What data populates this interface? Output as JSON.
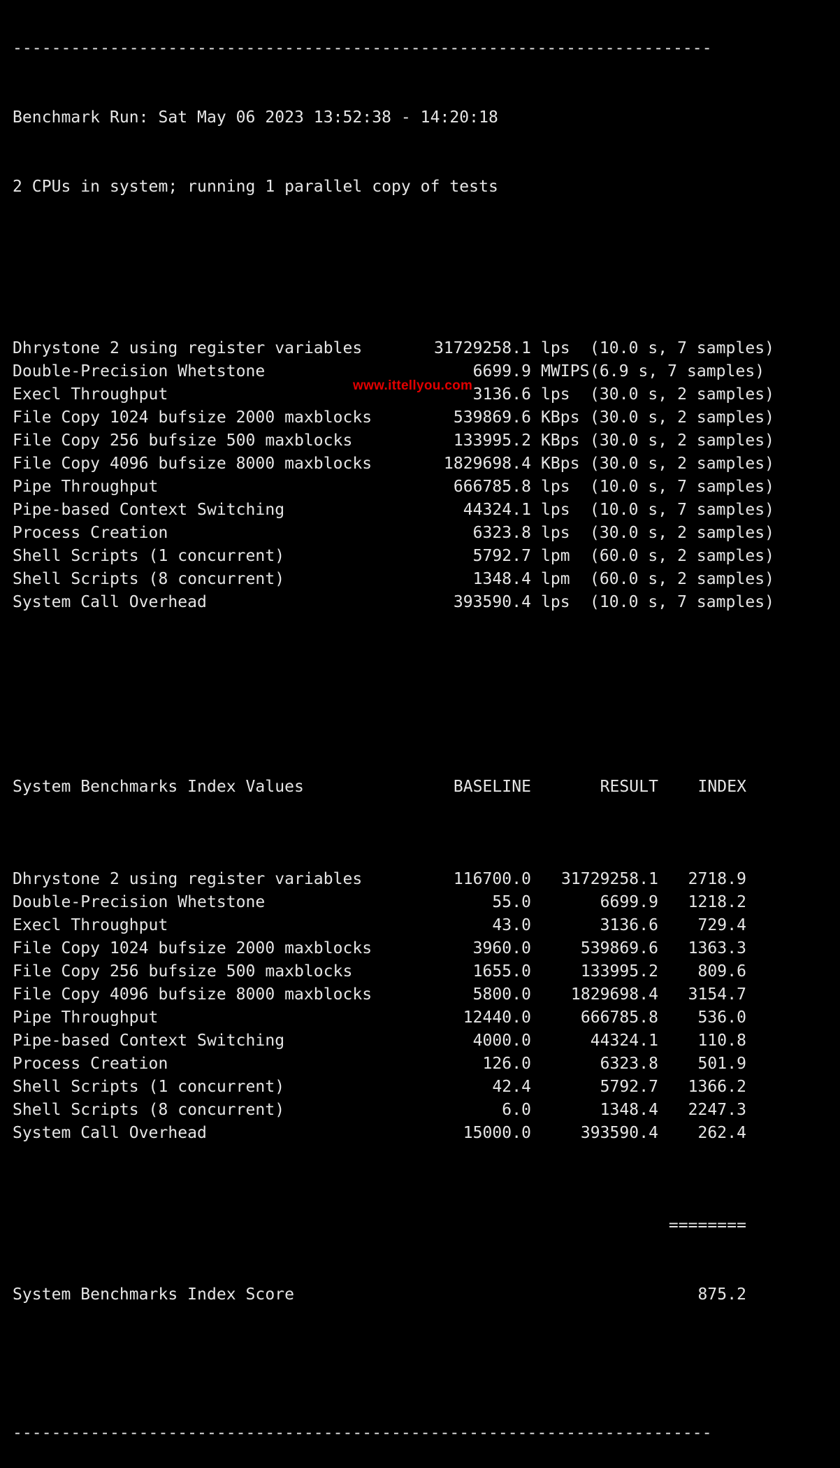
{
  "terminal": {
    "divider_top": "------------------------------------------------------------------------",
    "run_line": "Benchmark Run: Sat May 06 2023 13:52:38 - 14:20:18",
    "cpu_line": "2 CPUs in system; running 1 parallel copy of tests",
    "raw_results": [
      {
        "name": "Dhrystone 2 using register variables",
        "value": "31729258.1",
        "unit": "lps",
        "detail": "(10.0 s, 7 samples)"
      },
      {
        "name": "Double-Precision Whetstone",
        "value": "6699.9",
        "unit": "MWIPS",
        "detail": "(6.9 s, 7 samples)"
      },
      {
        "name": "Execl Throughput",
        "value": "3136.6",
        "unit": "lps",
        "detail": "(30.0 s, 2 samples)"
      },
      {
        "name": "File Copy 1024 bufsize 2000 maxblocks",
        "value": "539869.6",
        "unit": "KBps",
        "detail": "(30.0 s, 2 samples)"
      },
      {
        "name": "File Copy 256 bufsize 500 maxblocks",
        "value": "133995.2",
        "unit": "KBps",
        "detail": "(30.0 s, 2 samples)"
      },
      {
        "name": "File Copy 4096 bufsize 8000 maxblocks",
        "value": "1829698.4",
        "unit": "KBps",
        "detail": "(30.0 s, 2 samples)"
      },
      {
        "name": "Pipe Throughput",
        "value": "666785.8",
        "unit": "lps",
        "detail": "(10.0 s, 7 samples)"
      },
      {
        "name": "Pipe-based Context Switching",
        "value": "44324.1",
        "unit": "lps",
        "detail": "(10.0 s, 7 samples)"
      },
      {
        "name": "Process Creation",
        "value": "6323.8",
        "unit": "lps",
        "detail": "(30.0 s, 2 samples)"
      },
      {
        "name": "Shell Scripts (1 concurrent)",
        "value": "5792.7",
        "unit": "lpm",
        "detail": "(60.0 s, 2 samples)"
      },
      {
        "name": "Shell Scripts (8 concurrent)",
        "value": "1348.4",
        "unit": "lpm",
        "detail": "(60.0 s, 2 samples)"
      },
      {
        "name": "System Call Overhead",
        "value": "393590.4",
        "unit": "lps",
        "detail": "(10.0 s, 7 samples)"
      }
    ],
    "index_header": {
      "title": "System Benchmarks Index Values",
      "baseline": "BASELINE",
      "result": "RESULT",
      "index": "INDEX"
    },
    "index_rows": [
      {
        "name": "Dhrystone 2 using register variables",
        "baseline": "116700.0",
        "result": "31729258.1",
        "index": "2718.9"
      },
      {
        "name": "Double-Precision Whetstone",
        "baseline": "55.0",
        "result": "6699.9",
        "index": "1218.2"
      },
      {
        "name": "Execl Throughput",
        "baseline": "43.0",
        "result": "3136.6",
        "index": "729.4"
      },
      {
        "name": "File Copy 1024 bufsize 2000 maxblocks",
        "baseline": "3960.0",
        "result": "539869.6",
        "index": "1363.3"
      },
      {
        "name": "File Copy 256 bufsize 500 maxblocks",
        "baseline": "1655.0",
        "result": "133995.2",
        "index": "809.6"
      },
      {
        "name": "File Copy 4096 bufsize 8000 maxblocks",
        "baseline": "5800.0",
        "result": "1829698.4",
        "index": "3154.7"
      },
      {
        "name": "Pipe Throughput",
        "baseline": "12440.0",
        "result": "666785.8",
        "index": "536.0"
      },
      {
        "name": "Pipe-based Context Switching",
        "baseline": "4000.0",
        "result": "44324.1",
        "index": "110.8"
      },
      {
        "name": "Process Creation",
        "baseline": "126.0",
        "result": "6323.8",
        "index": "501.9"
      },
      {
        "name": "Shell Scripts (1 concurrent)",
        "baseline": "42.4",
        "result": "5792.7",
        "index": "1366.2"
      },
      {
        "name": "Shell Scripts (8 concurrent)",
        "baseline": "6.0",
        "result": "1348.4",
        "index": "2247.3"
      },
      {
        "name": "System Call Overhead",
        "baseline": "15000.0",
        "result": "393590.4",
        "index": "262.4"
      }
    ],
    "score_separator": "========",
    "score_label": "System Benchmarks Index Score",
    "score_value": "875.2",
    "divider_bottom": "------------------------------------------------------------------------"
  },
  "watermark": {
    "text": "www.ittellyou.com",
    "color": "#e10000"
  }
}
